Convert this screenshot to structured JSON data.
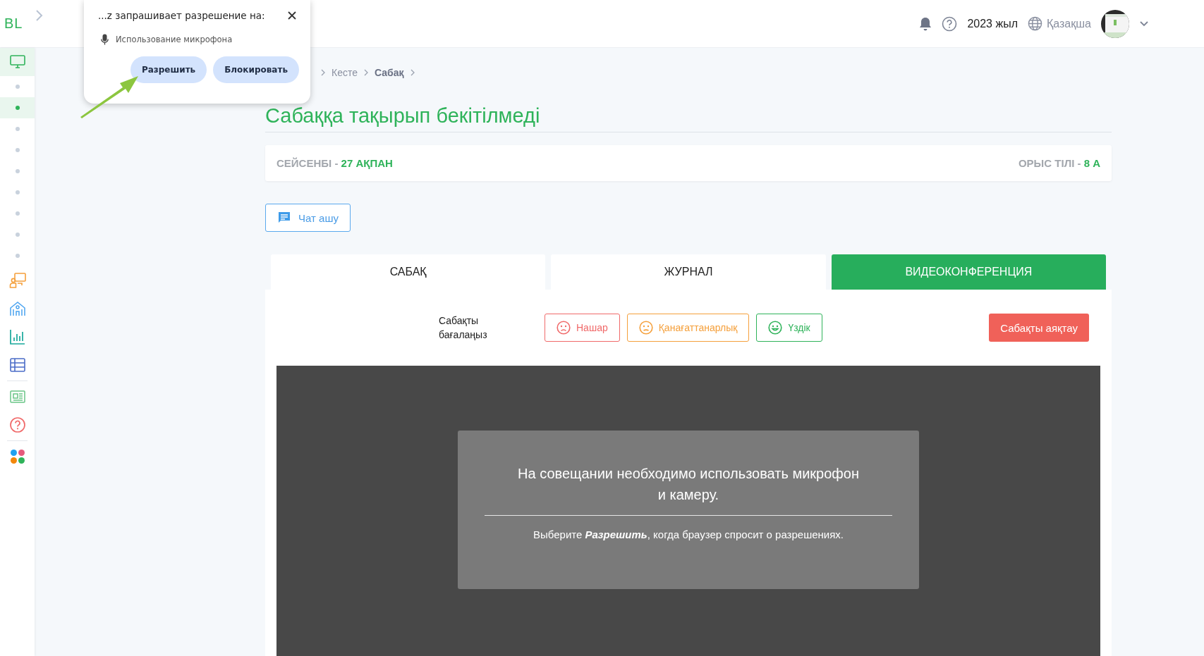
{
  "header": {
    "logo": "BL",
    "year": "2023 жыл",
    "language": "Қазақша"
  },
  "sidebar": {
    "items": [
      {
        "kind": "monitor",
        "selected": true,
        "separator_before": false
      },
      {
        "kind": "dot",
        "selected": false,
        "separator_before": false
      },
      {
        "kind": "dot",
        "selected": true,
        "separator_before": false
      },
      {
        "kind": "dot",
        "selected": false,
        "separator_before": false
      },
      {
        "kind": "dot",
        "selected": false,
        "separator_before": false
      },
      {
        "kind": "dot",
        "selected": false,
        "separator_before": false
      },
      {
        "kind": "dot",
        "selected": false,
        "separator_before": false
      },
      {
        "kind": "dot",
        "selected": false,
        "separator_before": false
      },
      {
        "kind": "dot",
        "selected": false,
        "separator_before": false
      },
      {
        "kind": "dot",
        "selected": false,
        "separator_before": false
      },
      {
        "kind": "presenter",
        "selected": false,
        "separator_before": false
      },
      {
        "kind": "building",
        "selected": false,
        "separator_before": false
      },
      {
        "kind": "chart",
        "selected": false,
        "separator_before": false
      },
      {
        "kind": "table",
        "selected": false,
        "separator_before": false
      },
      {
        "kind": "newspaper",
        "selected": false,
        "separator_before": true
      },
      {
        "kind": "help",
        "selected": false,
        "separator_before": false
      },
      {
        "kind": "apps",
        "selected": false,
        "separator_before": true
      }
    ]
  },
  "permission_popup": {
    "title": "...z запрашивает разрешение на:",
    "permission": "Использование микрофона",
    "buttons": [
      "Разрешить",
      "Блокировать"
    ]
  },
  "breadcrumb": [
    {
      "label": "Кесте",
      "current": false
    },
    {
      "label": "Сабақ",
      "current": true
    }
  ],
  "title": "Сабаққа тақырып бекітілмеді",
  "date_card": {
    "day": "СЕЙСЕНБІ -",
    "date": "27 АҚПАН",
    "subject": "ОРЫС ТІЛІ -",
    "class": "8 А"
  },
  "chat_button": "Чат ашу",
  "tabs": [
    {
      "label": "САБАҚ",
      "selected": false
    },
    {
      "label": "ЖУРНАЛ",
      "selected": false
    },
    {
      "label": "ВИДЕОКОНФЕРЕНЦИЯ",
      "selected": true
    }
  ],
  "rating": {
    "label": "Сабақты бағалаңыз",
    "options": [
      {
        "label": "Нашар",
        "kind": "sad",
        "color": "#f06a6a"
      },
      {
        "label": "Қанағаттанарлық",
        "kind": "neutral",
        "color": "#f5a03c"
      },
      {
        "label": "Үздік",
        "kind": "happy",
        "color": "#2fb35a"
      }
    ]
  },
  "end_button": "Сабақты аяқтау",
  "video": {
    "message": "На совещании необходимо использовать микрофон и камеру.",
    "hint": "Выберите **Разрешить**, когда браузер спросит о разрешениях."
  }
}
